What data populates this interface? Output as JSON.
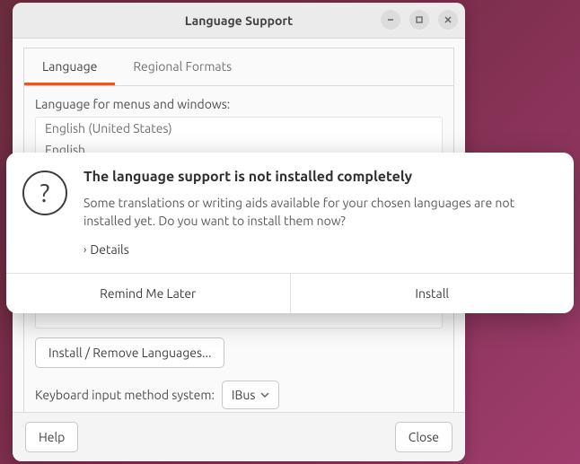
{
  "window": {
    "title": "Language Support",
    "tabs": [
      {
        "label": "Language"
      },
      {
        "label": "Regional Formats"
      }
    ],
    "language_section_label": "Language for menus and windows:",
    "language_list": [
      "English (United States)",
      "English"
    ],
    "install_remove_btn": "Install / Remove Languages...",
    "keyboard_label": "Keyboard input method system:",
    "keyboard_value": "IBus",
    "footer": {
      "help": "Help",
      "close": "Close"
    }
  },
  "dialog": {
    "title": "The language support is not installed completely",
    "message": "Some translations or writing aids available for your chosen languages are not installed yet. Do you want to install them now?",
    "details_label": "Details",
    "actions": {
      "remind": "Remind Me Later",
      "install": "Install"
    }
  }
}
